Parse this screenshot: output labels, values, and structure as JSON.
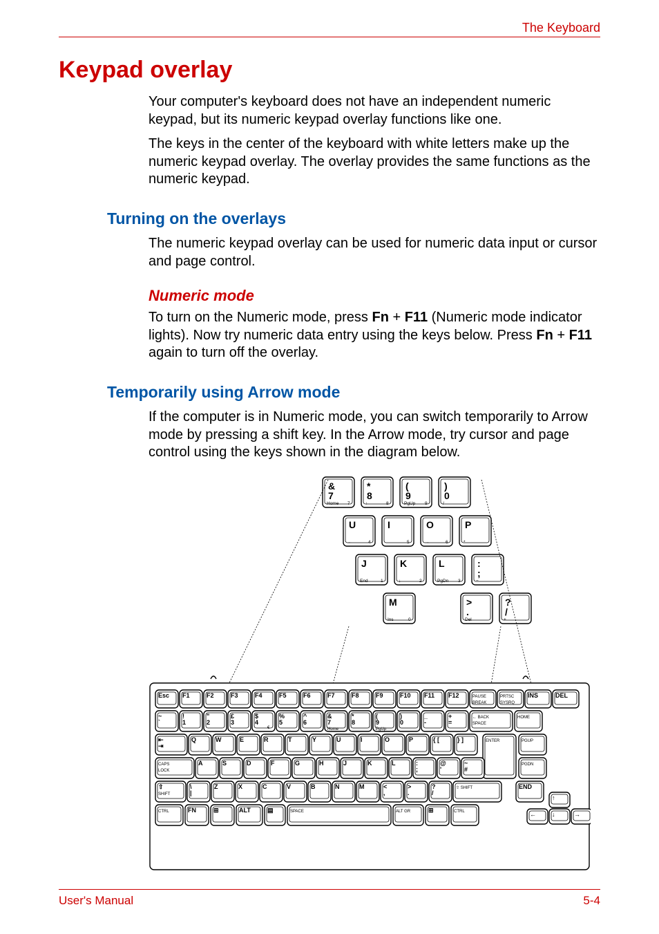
{
  "header": {
    "label": "The Keyboard"
  },
  "title": "Keypad overlay",
  "intro": {
    "p1": "Your computer's keyboard does not have an independent numeric keypad, but its numeric keypad overlay functions like one.",
    "p2": "The keys in the center of the keyboard with white letters make up the numeric keypad overlay. The overlay provides the same functions as the numeric keypad."
  },
  "sections": {
    "turning_on": {
      "heading": "Turning on the overlays",
      "p1": "The numeric keypad overlay can be used for numeric data input or cursor and page control."
    },
    "numeric_mode": {
      "heading": "Numeric mode",
      "p_pre": "To turn on the Numeric mode, press ",
      "fn1": "Fn",
      "plus1": " + ",
      "f11_1": "F11",
      "p_mid": " (Numeric mode indicator lights). Now try numeric data entry using the keys below. Press ",
      "fn2": "Fn",
      "plus2": " + ",
      "f11_2": "F11",
      "p_post": " again to turn off the overlay."
    },
    "arrow_mode": {
      "heading": "Temporarily using Arrow mode",
      "p1": "If the computer is in Numeric mode, you can switch temporarily to Arrow mode by pressing a shift key. In the Arrow mode, try cursor and page control using the keys shown in the diagram below."
    }
  },
  "diagram": {
    "overlay_keys": {
      "row1": [
        {
          "main": "&",
          "sub": "7",
          "ov": "Home",
          "n": "7"
        },
        {
          "main": "*",
          "sub": "8",
          "ov": "↑",
          "n": "8"
        },
        {
          "main": "(",
          "sub": "9",
          "ov": "PgUp",
          "n": "9"
        },
        {
          "main": ")",
          "sub": "0",
          "ov": "/",
          "n": ""
        }
      ],
      "row2": [
        {
          "main": "U",
          "ov": "←",
          "n": "4"
        },
        {
          "main": "I",
          "ov": "",
          "n": "5"
        },
        {
          "main": "O",
          "ov": "→",
          "n": "6"
        },
        {
          "main": "P",
          "ov": "*",
          "n": ""
        }
      ],
      "row3": [
        {
          "main": "J",
          "ov": "End",
          "n": "1"
        },
        {
          "main": "K",
          "ov": "↓",
          "n": "2"
        },
        {
          "main": "L",
          "ov": "PgDn",
          "n": "3"
        },
        {
          "main": ":",
          "sub": ";",
          "ov": "−",
          "n": ""
        }
      ],
      "row4": [
        {
          "main": "M",
          "ov": "Ins",
          "n": "0"
        },
        {
          "main": "",
          "sub": "",
          "ov": "",
          "n": ""
        },
        {
          "main": ">",
          "sub": ".",
          "ov": "Del",
          "n": ""
        },
        {
          "main": "?",
          "sub": "/",
          "ov": "+",
          "n": ""
        }
      ]
    },
    "keyboard": {
      "row_fn": [
        "Esc",
        "F1",
        "F2",
        "F3",
        "F4",
        "F5",
        "F6",
        "F7",
        "F8",
        "F9",
        "F10",
        "F11",
        "F12",
        "PAUSE BREAK",
        "PRTSC SYSRQ",
        "INS",
        "DEL"
      ],
      "row_num": [
        {
          "t": "~",
          "b": "`"
        },
        {
          "t": "!",
          "b": "1"
        },
        {
          "t": "\"",
          "b": "2"
        },
        {
          "t": "£",
          "b": "3"
        },
        {
          "t": "$",
          "b": "4",
          "e": "€"
        },
        {
          "t": "%",
          "b": "5"
        },
        {
          "t": "^",
          "b": "6"
        },
        {
          "t": "&",
          "b": "7",
          "ov": "Home"
        },
        {
          "t": "*",
          "b": "8"
        },
        {
          "t": "(",
          "b": "9",
          "ov": "PgUp"
        },
        {
          "t": ")",
          "b": "0"
        },
        {
          "t": "_",
          "b": "-"
        },
        {
          "t": "+",
          "b": "="
        }
      ],
      "row_num_right": [
        "BACK SPACE",
        "HOME"
      ],
      "row_q": {
        "tab": "↹",
        "keys": [
          "Q",
          "W",
          "E",
          "R",
          "T",
          "Y",
          "U",
          "I",
          "O",
          "P",
          "{ [",
          "} ]"
        ],
        "right": [
          "ENTER",
          "PGUP"
        ]
      },
      "row_a": {
        "caps": "CAPS LOCK",
        "keys": [
          "A",
          "S",
          "D",
          "F",
          "G",
          "H",
          "J",
          "K",
          "L",
          ": ;",
          "@ '",
          "~ #"
        ],
        "right": [
          "↵",
          "PGDN"
        ]
      },
      "row_z": {
        "shift": "⇧ SHIFT",
        "keys": [
          "\\ |",
          "Z",
          "X",
          "C",
          "V",
          "B",
          "N",
          "M",
          "< ,",
          "> .",
          "? /"
        ],
        "shift_r": "⇧ SHIFT",
        "right": [
          "END"
        ]
      },
      "row_space": {
        "keys": [
          "CTRL",
          "FN",
          "⊞",
          "ALT",
          "▤",
          "SPACE",
          "ALT GR",
          "⊞",
          "CTRL"
        ],
        "arrows": [
          "↑",
          "←",
          "↓",
          "→"
        ]
      }
    }
  },
  "footer": {
    "left": "User's Manual",
    "right": "5-4"
  }
}
